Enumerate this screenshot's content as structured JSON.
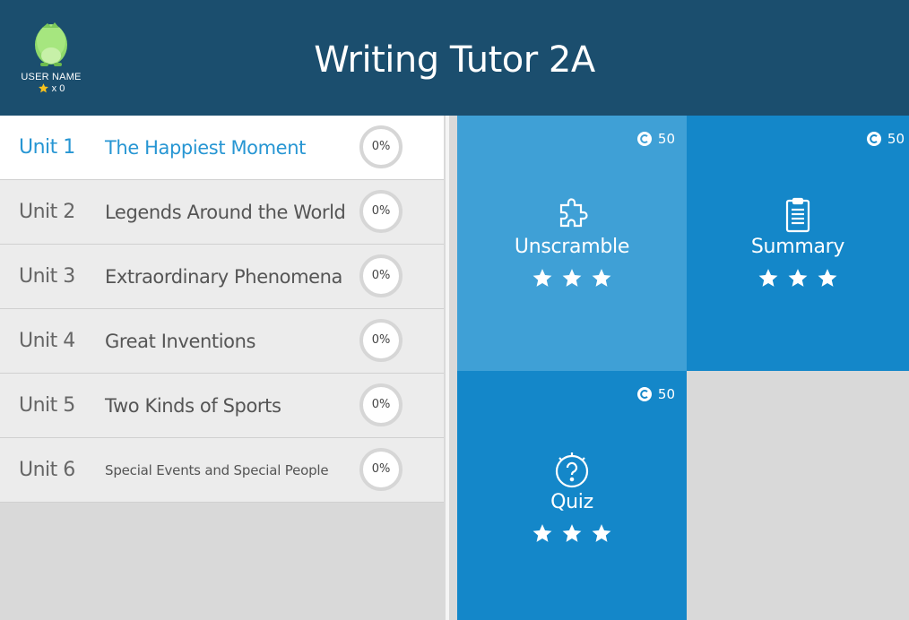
{
  "header": {
    "title": "Writing Tutor 2A",
    "user_name": "USER NAME",
    "star_count": "x 0",
    "avatar_icon": "green-dinosaur-egg-icon"
  },
  "units": [
    {
      "unit": "Unit 1",
      "title": "The Happiest Moment",
      "progress": "0%",
      "active": true
    },
    {
      "unit": "Unit 2",
      "title": "Legends Around the World",
      "progress": "0%",
      "active": false
    },
    {
      "unit": "Unit 3",
      "title": "Extraordinary Phenomena",
      "progress": "0%",
      "active": false
    },
    {
      "unit": "Unit 4",
      "title": "Great Inventions",
      "progress": "0%",
      "active": false
    },
    {
      "unit": "Unit 5",
      "title": "Two Kinds of Sports",
      "progress": "0%",
      "active": false
    },
    {
      "unit": "Unit 6",
      "title": "Special Events and Special People",
      "progress": "0%",
      "active": false
    }
  ],
  "activities": [
    {
      "label": "Unscramble",
      "points": "50",
      "icon": "puzzle-icon",
      "stars": 3
    },
    {
      "label": "Summary",
      "points": "50",
      "icon": "clipboard-icon",
      "stars": 3
    },
    {
      "label": "Quiz",
      "points": "50",
      "icon": "question-bulb-icon",
      "stars": 3
    }
  ],
  "colors": {
    "header_bg": "#1b4e6e",
    "active_text": "#2796d3",
    "tile_light": "#3fa0d6",
    "tile_dark": "#1487c9",
    "panel_bg": "#d9d9d9"
  }
}
